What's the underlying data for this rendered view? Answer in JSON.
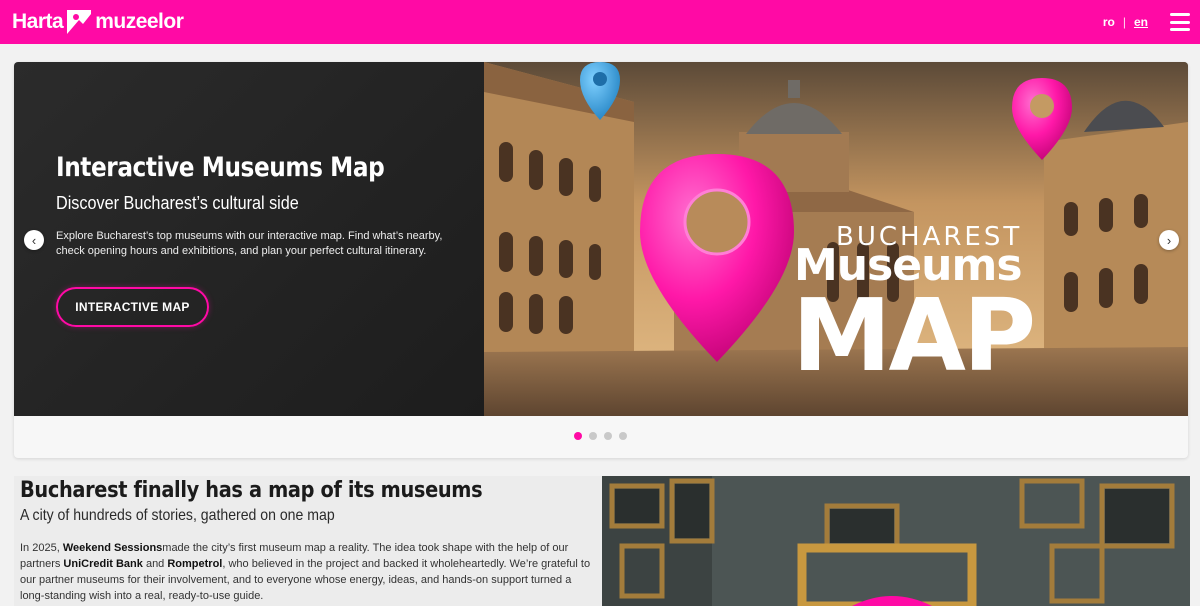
{
  "header": {
    "logo_left": "Harta",
    "logo_right": "muzeelor",
    "lang_ro": "ro",
    "lang_sep": "|",
    "lang_en": "en"
  },
  "hero": {
    "title": "Interactive Museums Map",
    "subtitle": "Discover Bucharest’s cultural side",
    "description": "Explore Bucharest’s top museums with our interactive map. Find what’s nearby, check opening hours and exhibitions, and plan your perfect cultural itinerary.",
    "button_label": "INTERACTIVE MAP",
    "image_text_line1": "BUCHAREST",
    "image_text_line2": "Museums",
    "image_text_line3": "MAP",
    "prev_arrow": "‹",
    "next_arrow": "›",
    "active_slide": 1,
    "slide_count": 4
  },
  "intro": {
    "title": "Bucharest finally has a map of its museums",
    "subtitle": "A city of hundreds of stories, gathered on one map",
    "body_p1": "In 2025, ",
    "body_b1": "Weekend Sessions",
    "body_p2": "made the city’s first museum map a reality. The idea took shape with the help of our partners ",
    "body_b2": "UniCredit Bank",
    "body_p3": " and ",
    "body_b3": "Rompetrol",
    "body_p4": ", who believed in the project and backed it wholeheartedly. We’re grateful to our partner museums for their involvement, and to everyone whose energy, ideas, and hands-on support turned a long-standing wish into a real, ready-to-use guide."
  },
  "colors": {
    "brand": "#ff0aa5",
    "hero_dark": "#242424"
  },
  "icons": [
    "logo-mark-icon",
    "menu-icon",
    "chevron-left-icon",
    "chevron-right-icon",
    "map-pin-icon"
  ]
}
